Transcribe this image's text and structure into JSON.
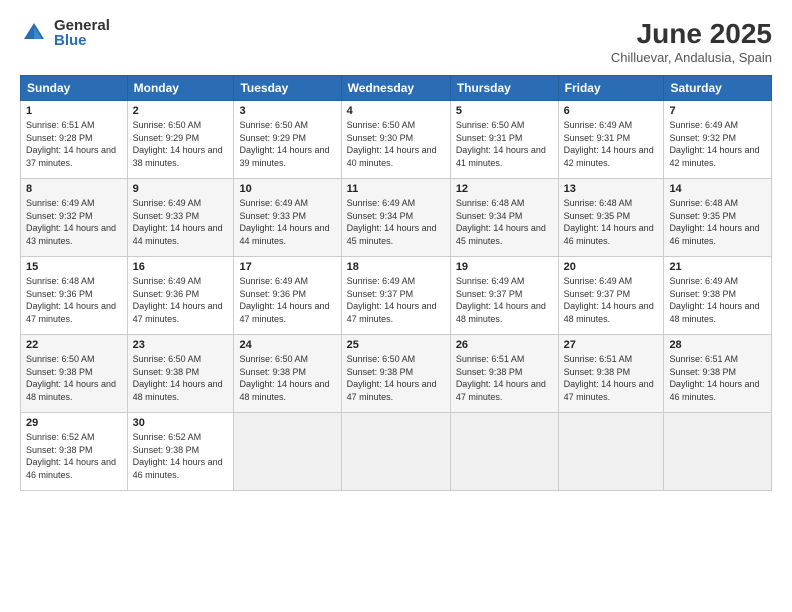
{
  "logo": {
    "general": "General",
    "blue": "Blue"
  },
  "header": {
    "month_year": "June 2025",
    "location": "Chilluevar, Andalusia, Spain"
  },
  "weekdays": [
    "Sunday",
    "Monday",
    "Tuesday",
    "Wednesday",
    "Thursday",
    "Friday",
    "Saturday"
  ],
  "weeks": [
    [
      {
        "day": "1",
        "sunrise": "6:51 AM",
        "sunset": "9:28 PM",
        "daylight": "14 hours and 37 minutes."
      },
      {
        "day": "2",
        "sunrise": "6:50 AM",
        "sunset": "9:29 PM",
        "daylight": "14 hours and 38 minutes."
      },
      {
        "day": "3",
        "sunrise": "6:50 AM",
        "sunset": "9:29 PM",
        "daylight": "14 hours and 39 minutes."
      },
      {
        "day": "4",
        "sunrise": "6:50 AM",
        "sunset": "9:30 PM",
        "daylight": "14 hours and 40 minutes."
      },
      {
        "day": "5",
        "sunrise": "6:50 AM",
        "sunset": "9:31 PM",
        "daylight": "14 hours and 41 minutes."
      },
      {
        "day": "6",
        "sunrise": "6:49 AM",
        "sunset": "9:31 PM",
        "daylight": "14 hours and 42 minutes."
      },
      {
        "day": "7",
        "sunrise": "6:49 AM",
        "sunset": "9:32 PM",
        "daylight": "14 hours and 42 minutes."
      }
    ],
    [
      {
        "day": "8",
        "sunrise": "6:49 AM",
        "sunset": "9:32 PM",
        "daylight": "14 hours and 43 minutes."
      },
      {
        "day": "9",
        "sunrise": "6:49 AM",
        "sunset": "9:33 PM",
        "daylight": "14 hours and 44 minutes."
      },
      {
        "day": "10",
        "sunrise": "6:49 AM",
        "sunset": "9:33 PM",
        "daylight": "14 hours and 44 minutes."
      },
      {
        "day": "11",
        "sunrise": "6:49 AM",
        "sunset": "9:34 PM",
        "daylight": "14 hours and 45 minutes."
      },
      {
        "day": "12",
        "sunrise": "6:48 AM",
        "sunset": "9:34 PM",
        "daylight": "14 hours and 45 minutes."
      },
      {
        "day": "13",
        "sunrise": "6:48 AM",
        "sunset": "9:35 PM",
        "daylight": "14 hours and 46 minutes."
      },
      {
        "day": "14",
        "sunrise": "6:48 AM",
        "sunset": "9:35 PM",
        "daylight": "14 hours and 46 minutes."
      }
    ],
    [
      {
        "day": "15",
        "sunrise": "6:48 AM",
        "sunset": "9:36 PM",
        "daylight": "14 hours and 47 minutes."
      },
      {
        "day": "16",
        "sunrise": "6:49 AM",
        "sunset": "9:36 PM",
        "daylight": "14 hours and 47 minutes."
      },
      {
        "day": "17",
        "sunrise": "6:49 AM",
        "sunset": "9:36 PM",
        "daylight": "14 hours and 47 minutes."
      },
      {
        "day": "18",
        "sunrise": "6:49 AM",
        "sunset": "9:37 PM",
        "daylight": "14 hours and 47 minutes."
      },
      {
        "day": "19",
        "sunrise": "6:49 AM",
        "sunset": "9:37 PM",
        "daylight": "14 hours and 48 minutes."
      },
      {
        "day": "20",
        "sunrise": "6:49 AM",
        "sunset": "9:37 PM",
        "daylight": "14 hours and 48 minutes."
      },
      {
        "day": "21",
        "sunrise": "6:49 AM",
        "sunset": "9:38 PM",
        "daylight": "14 hours and 48 minutes."
      }
    ],
    [
      {
        "day": "22",
        "sunrise": "6:50 AM",
        "sunset": "9:38 PM",
        "daylight": "14 hours and 48 minutes."
      },
      {
        "day": "23",
        "sunrise": "6:50 AM",
        "sunset": "9:38 PM",
        "daylight": "14 hours and 48 minutes."
      },
      {
        "day": "24",
        "sunrise": "6:50 AM",
        "sunset": "9:38 PM",
        "daylight": "14 hours and 48 minutes."
      },
      {
        "day": "25",
        "sunrise": "6:50 AM",
        "sunset": "9:38 PM",
        "daylight": "14 hours and 47 minutes."
      },
      {
        "day": "26",
        "sunrise": "6:51 AM",
        "sunset": "9:38 PM",
        "daylight": "14 hours and 47 minutes."
      },
      {
        "day": "27",
        "sunrise": "6:51 AM",
        "sunset": "9:38 PM",
        "daylight": "14 hours and 47 minutes."
      },
      {
        "day": "28",
        "sunrise": "6:51 AM",
        "sunset": "9:38 PM",
        "daylight": "14 hours and 46 minutes."
      }
    ],
    [
      {
        "day": "29",
        "sunrise": "6:52 AM",
        "sunset": "9:38 PM",
        "daylight": "14 hours and 46 minutes."
      },
      {
        "day": "30",
        "sunrise": "6:52 AM",
        "sunset": "9:38 PM",
        "daylight": "14 hours and 46 minutes."
      },
      null,
      null,
      null,
      null,
      null
    ]
  ]
}
